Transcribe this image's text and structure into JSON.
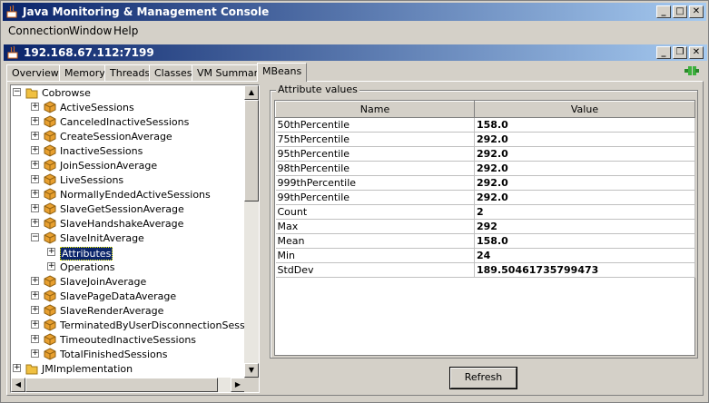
{
  "window": {
    "title": "Java Monitoring & Management Console",
    "controls": {
      "minimize": "_",
      "maximize": "□",
      "close": "✕"
    }
  },
  "menu": [
    "Connection",
    "Window",
    "Help"
  ],
  "connection": {
    "title": "192.168.67.112:7199",
    "controls": {
      "minimize": "_",
      "restore": "❐",
      "close": "✕"
    }
  },
  "tabs": [
    "Overview",
    "Memory",
    "Threads",
    "Classes",
    "VM Summary",
    "MBeans"
  ],
  "active_tab": "MBeans",
  "tree": {
    "root": "Cobrowse",
    "items": [
      "ActiveSessions",
      "CanceledInactiveSessions",
      "CreateSessionAverage",
      "InactiveSessions",
      "JoinSessionAverage",
      "LiveSessions",
      "NormallyEndedActiveSessions",
      "SlaveGetSessionAverage",
      "SlaveHandshakeAverage",
      "SlaveInitAverage"
    ],
    "expanded_children": [
      "Attributes",
      "Operations"
    ],
    "items_after": [
      "SlaveJoinAverage",
      "SlavePageDataAverage",
      "SlaveRenderAverage",
      "TerminatedByUserDisconnectionSessions",
      "TimeoutedInactiveSessions",
      "TotalFinishedSessions"
    ],
    "root2": "JMImplementation",
    "partial": "...............................................",
    "expander_collapsed": "+",
    "expander_expanded": "−"
  },
  "attributes": {
    "group_label": "Attribute values",
    "columns": [
      "Name",
      "Value"
    ],
    "rows": [
      [
        "50thPercentile",
        "158.0"
      ],
      [
        "75thPercentile",
        "292.0"
      ],
      [
        "95thPercentile",
        "292.0"
      ],
      [
        "98thPercentile",
        "292.0"
      ],
      [
        "999thPercentile",
        "292.0"
      ],
      [
        "99thPercentile",
        "292.0"
      ],
      [
        "Count",
        "2"
      ],
      [
        "Max",
        "292"
      ],
      [
        "Mean",
        "158.0"
      ],
      [
        "Min",
        "24"
      ],
      [
        "StdDev",
        "189.50461735799473"
      ]
    ],
    "refresh_label": "Refresh"
  },
  "scroll": {
    "up": "▲",
    "down": "▼",
    "left": "◀",
    "right": "▶"
  },
  "colors": {
    "title_bar": "#0a246a",
    "selection": "#0a246a",
    "folder": "#f0c040",
    "bean": "#e8a030"
  }
}
